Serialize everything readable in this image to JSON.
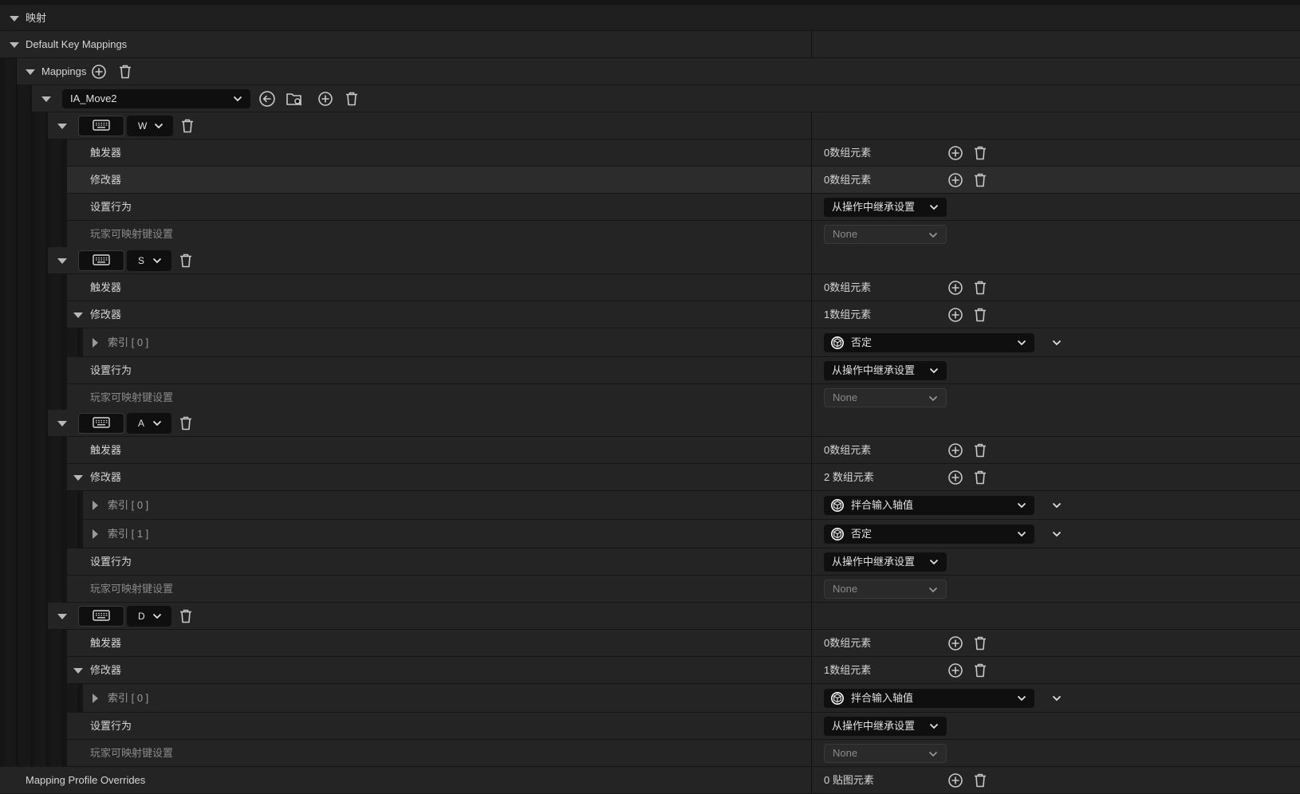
{
  "section_title": "映射",
  "default_key_mappings_label": "Default Key Mappings",
  "mappings_label": "Mappings",
  "action": {
    "value": "IA_Move2"
  },
  "keys": [
    {
      "key": "W",
      "triggers": {
        "label": "触发器",
        "count": "0数组元素"
      },
      "modifiers": {
        "label": "修改器",
        "count": "0数组元素",
        "items": []
      },
      "behavior": {
        "label": "设置行为",
        "value": "从操作中继承设置"
      },
      "player_settings": {
        "label": "玩家可映射键设置",
        "value": "None"
      }
    },
    {
      "key": "S",
      "triggers": {
        "label": "触发器",
        "count": "0数组元素"
      },
      "modifiers": {
        "label": "修改器",
        "count": "1数组元素",
        "items": [
          {
            "index": "索引 [ 0 ]",
            "value": "否定"
          }
        ]
      },
      "behavior": {
        "label": "设置行为",
        "value": "从操作中继承设置"
      },
      "player_settings": {
        "label": "玩家可映射键设置",
        "value": "None"
      }
    },
    {
      "key": "A",
      "triggers": {
        "label": "触发器",
        "count": "0数组元素"
      },
      "modifiers": {
        "label": "修改器",
        "count": "2 数组元素",
        "items": [
          {
            "index": "索引 [ 0 ]",
            "value": "拌合输入轴值"
          },
          {
            "index": "索引 [ 1 ]",
            "value": "否定"
          }
        ]
      },
      "behavior": {
        "label": "设置行为",
        "value": "从操作中继承设置"
      },
      "player_settings": {
        "label": "玩家可映射键设置",
        "value": "None"
      }
    },
    {
      "key": "D",
      "triggers": {
        "label": "触发器",
        "count": "0数组元素"
      },
      "modifiers": {
        "label": "修改器",
        "count": "1数组元素",
        "items": [
          {
            "index": "索引 [ 0 ]",
            "value": "拌合输入轴值"
          }
        ]
      },
      "behavior": {
        "label": "设置行为",
        "value": "从操作中继承设置"
      },
      "player_settings": {
        "label": "玩家可映射键设置",
        "value": "None"
      }
    }
  ],
  "profile_overrides": {
    "label": "Mapping Profile Overrides",
    "count": "0 贴图元素"
  },
  "icons": {
    "expand": "triangle-down-icon",
    "collapsed": "triangle-right-icon",
    "add": "plus-circle-icon",
    "delete": "trash-icon",
    "keyboard": "keyboard-icon",
    "back": "arrow-back-circle-icon",
    "browse": "folder-search-icon",
    "modifier": "unreal-logo-icon",
    "chevron": "chevron-down-icon"
  },
  "colors": {
    "panel_bg": "#151515",
    "row_bg": "#242424",
    "combo_bg": "#0f0f0f",
    "text": "#d6d6d6",
    "dim_text": "#8a8a8a"
  }
}
